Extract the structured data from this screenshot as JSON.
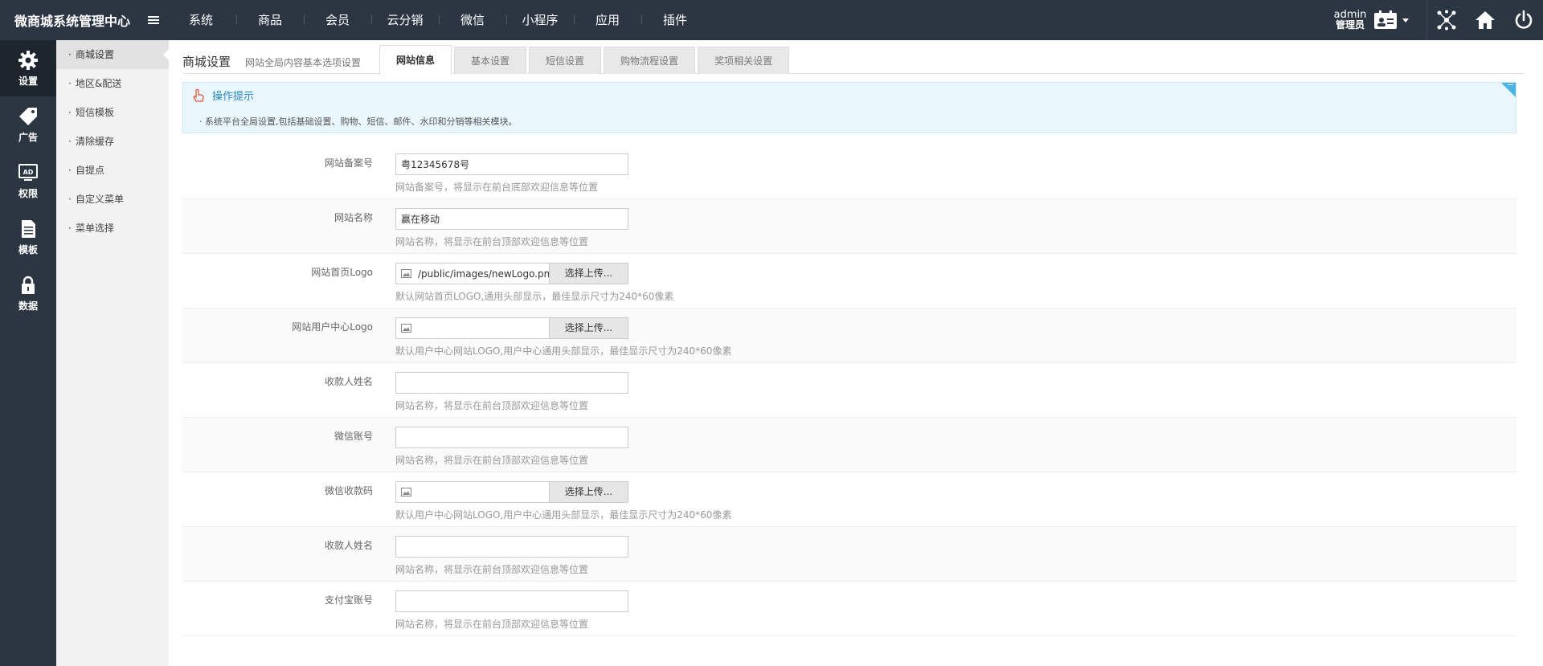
{
  "brand": {
    "title": "微商城系统管理中心"
  },
  "topnav": [
    "系统",
    "商品",
    "会员",
    "云分销",
    "微信",
    "小程序",
    "应用",
    "插件"
  ],
  "user": {
    "name": "admin",
    "role": "管理员"
  },
  "iconbar": [
    {
      "label": "设置",
      "icon": "gear-icon"
    },
    {
      "label": "广告",
      "icon": "tag-icon"
    },
    {
      "label": "权限",
      "icon": "ad-icon"
    },
    {
      "label": "模板",
      "icon": "document-icon"
    },
    {
      "label": "数据",
      "icon": "lock-icon"
    }
  ],
  "submenu": [
    "商城设置",
    "地区&配送",
    "短信模板",
    "清除缓存",
    "自提点",
    "自定义菜单",
    "菜单选择"
  ],
  "page": {
    "title": "商城设置",
    "subtitle": "网站全局内容基本选项设置"
  },
  "tabs": [
    "网站信息",
    "基本设置",
    "短信设置",
    "购物流程设置",
    "奖项相关设置"
  ],
  "tips": {
    "title": "操作提示",
    "text": "· 系统平台全局设置,包括基础设置、购物、短信、邮件、水印和分销等相关模块。"
  },
  "form": {
    "icp": {
      "label": "网站备案号",
      "value": "粤12345678号",
      "hint": "网站备案号，将显示在前台底部欢迎信息等位置"
    },
    "site_name": {
      "label": "网站名称",
      "value": "赢在移动",
      "hint": "网站名称，将显示在前台顶部欢迎信息等位置"
    },
    "logo": {
      "label": "网站首页Logo",
      "value": "/public/images/newLogo.png",
      "button": "选择上传...",
      "hint": "默认网站首页LOGO,通用头部显示，最佳显示尺寸为240*60像素"
    },
    "ucenter_logo": {
      "label": "网站用户中心Logo",
      "value": "",
      "button": "选择上传...",
      "hint": "默认用户中心网站LOGO,用户中心通用头部显示，最佳显示尺寸为240*60像素"
    },
    "payee_name": {
      "label": "收款人姓名",
      "value": "",
      "hint": "网站名称，将显示在前台顶部欢迎信息等位置"
    },
    "wechat_account": {
      "label": "微信账号",
      "value": "",
      "hint": "网站名称，将显示在前台顶部欢迎信息等位置"
    },
    "wechat_qr": {
      "label": "微信收款码",
      "value": "",
      "button": "选择上传...",
      "hint": "默认用户中心网站LOGO,用户中心通用头部显示，最佳显示尺寸为240*60像素"
    },
    "payee_name2": {
      "label": "收款人姓名",
      "value": "",
      "hint": "网站名称，将显示在前台顶部欢迎信息等位置"
    },
    "alipay_account": {
      "label": "支付宝账号",
      "value": "",
      "hint": "网站名称，将显示在前台顶部欢迎信息等位置"
    }
  },
  "colors": {
    "topbar": "#2b3642",
    "submenu": "#f2f2f2",
    "tips_bg": "#e9f7fd",
    "accent": "#2a8ac1"
  }
}
